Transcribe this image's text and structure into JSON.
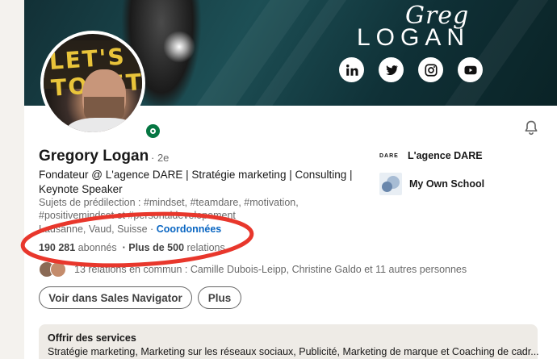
{
  "banner": {
    "script_text": "Greg",
    "brand_name": "LOGAN",
    "socials": [
      "linkedin-icon",
      "twitter-icon",
      "instagram-icon",
      "youtube-icon"
    ]
  },
  "avatar": {
    "sign_text": "LET'S TOGET"
  },
  "profile": {
    "name": "Gregory Logan",
    "degree": "· 2e",
    "headline": "Fondateur @ L'agence DARE | Stratégie marketing | Consulting | Keynote Speaker",
    "topics": "Sujets de prédilection : #mindset, #teamdare, #motivation, #positivemindset et #personaldevelopement",
    "location": "Lausanne, Vaud, Suisse · ",
    "contact_link": "Coordonnées",
    "followers": "190 281",
    "followers_label": "abonnés",
    "connections": "· Plus de 500",
    "connections_label": "relations",
    "mutual": "13 relations en commun : Camille Dubois-Leipp, Christine Galdo et 11 autres personnes"
  },
  "actions": {
    "sales_navigator": "Voir dans Sales Navigator",
    "more": "Plus"
  },
  "companies": [
    {
      "logo_text": "DARE",
      "name": "L'agence DARE"
    },
    {
      "name": "My Own School"
    }
  ],
  "services": {
    "title": "Offrir des services",
    "list": "Stratégie marketing, Marketing sur les réseaux sociaux, Publicité, Marketing de marque et Coaching de cadr..."
  },
  "colors": {
    "link_blue": "#0a66c2",
    "online_green": "#057642",
    "annotation_red": "#e8372c",
    "banner_teal": "#1d4f55"
  }
}
